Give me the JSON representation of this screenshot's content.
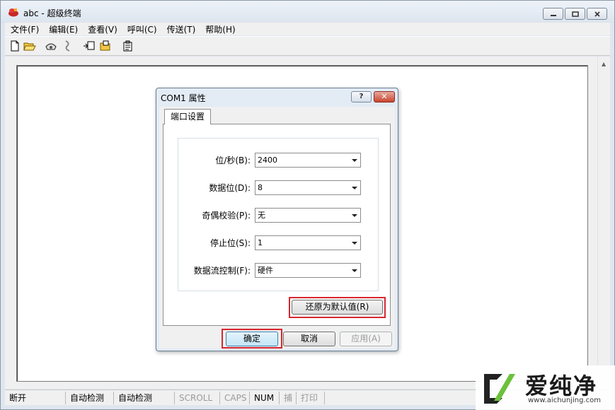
{
  "window": {
    "title": "abc - 超级终端",
    "menu": [
      "文件(F)",
      "编辑(E)",
      "查看(V)",
      "呼叫(C)",
      "传送(T)",
      "帮助(H)"
    ],
    "toolbar_icons": [
      "new-icon",
      "open-icon",
      "connect-icon",
      "disconnect-icon",
      "send-icon",
      "receive-icon",
      "properties-icon"
    ]
  },
  "status": {
    "cells": [
      {
        "text": "断开",
        "dim": false
      },
      {
        "text": "自动检测",
        "dim": false
      },
      {
        "text": "自动检测",
        "dim": false
      },
      {
        "text": "SCROLL",
        "dim": true
      },
      {
        "text": "CAPS",
        "dim": true
      },
      {
        "text": "NUM",
        "dim": false
      },
      {
        "text": "捕",
        "dim": true
      },
      {
        "text": "打印",
        "dim": true
      }
    ]
  },
  "dialog": {
    "title": "COM1 属性",
    "help_label": "?",
    "tab_label": "端口设置",
    "fields": [
      {
        "label": "位/秒(B):",
        "value": "2400"
      },
      {
        "label": "数据位(D):",
        "value": "8"
      },
      {
        "label": "奇偶校验(P):",
        "value": "无"
      },
      {
        "label": "停止位(S):",
        "value": "1"
      },
      {
        "label": "数据流控制(F):",
        "value": "硬件"
      }
    ],
    "restore_label": "还原为默认值(R)",
    "ok_label": "确定",
    "cancel_label": "取消",
    "apply_label": "应用(A)"
  },
  "watermark": {
    "text": "爱纯净",
    "url": "www.aichunjing.com"
  },
  "colors": {
    "highlight": "#d9272e",
    "close_red": "#c9452f"
  }
}
